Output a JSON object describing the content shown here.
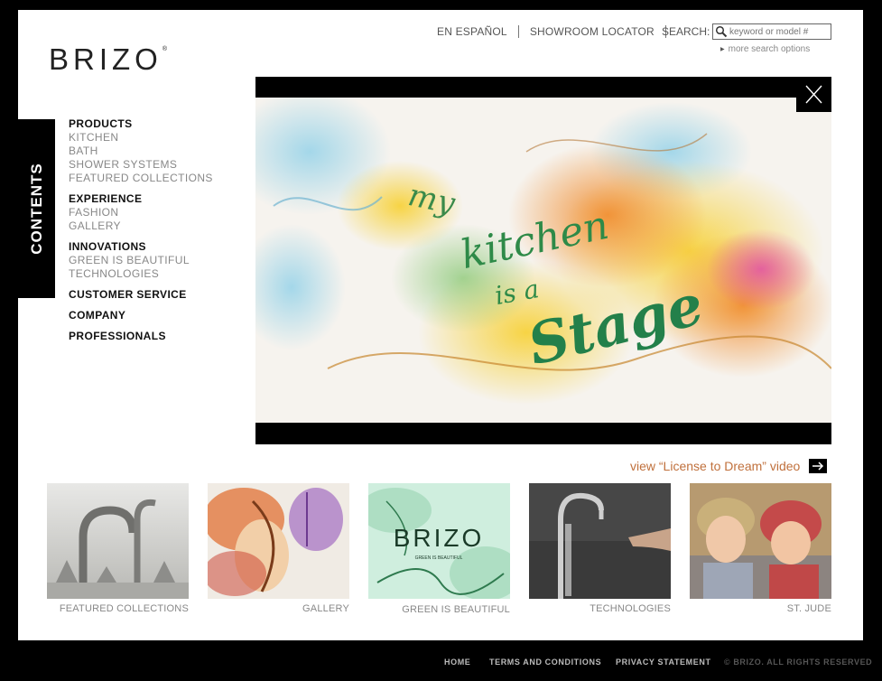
{
  "brand": {
    "logo_text": "BRIZO",
    "reg": "®"
  },
  "topnav": {
    "espanol": "EN ESPAÑOL",
    "showroom": "SHOWROOM LOCATOR",
    "search_label": "SEARCH:",
    "search_placeholder": "keyword or model #",
    "more_search": "more search options"
  },
  "contents_tab": "CONTENTS",
  "menu": {
    "products": {
      "label": "PRODUCTS",
      "items": [
        "KITCHEN",
        "BATH",
        "SHOWER SYSTEMS",
        "FEATURED COLLECTIONS"
      ]
    },
    "experience": {
      "label": "EXPERIENCE",
      "items": [
        "FASHION",
        "GALLERY"
      ]
    },
    "innovations": {
      "label": "INNOVATIONS",
      "items": [
        "GREEN IS BEAUTIFUL",
        "TECHNOLOGIES"
      ]
    },
    "customer_service": "CUSTOMER SERVICE",
    "company": "COMPANY",
    "professionals": "PROFESSIONALS"
  },
  "video": {
    "line1": "my",
    "line2": "kitchen",
    "line3": "is a",
    "line4": "Stage"
  },
  "video_link": "view “License to Dream” video",
  "thumbs": [
    {
      "label": "FEATURED COLLECTIONS"
    },
    {
      "label": "GALLERY"
    },
    {
      "label": "GREEN IS BEAUTIFUL",
      "logo": "BRIZO",
      "tag": "GREEN IS BEAUTIFUL"
    },
    {
      "label": "TECHNOLOGIES"
    },
    {
      "label": "ST. JUDE"
    }
  ],
  "footer": {
    "home": "HOME",
    "terms": "TERMS AND CONDITIONS",
    "privacy": "PRIVACY STATEMENT",
    "copyright": "© BRIZO. ALL RIGHTS RESERVED"
  },
  "colors": {
    "accent": "#c0703c",
    "background": "#000000",
    "panel": "#ffffff"
  }
}
